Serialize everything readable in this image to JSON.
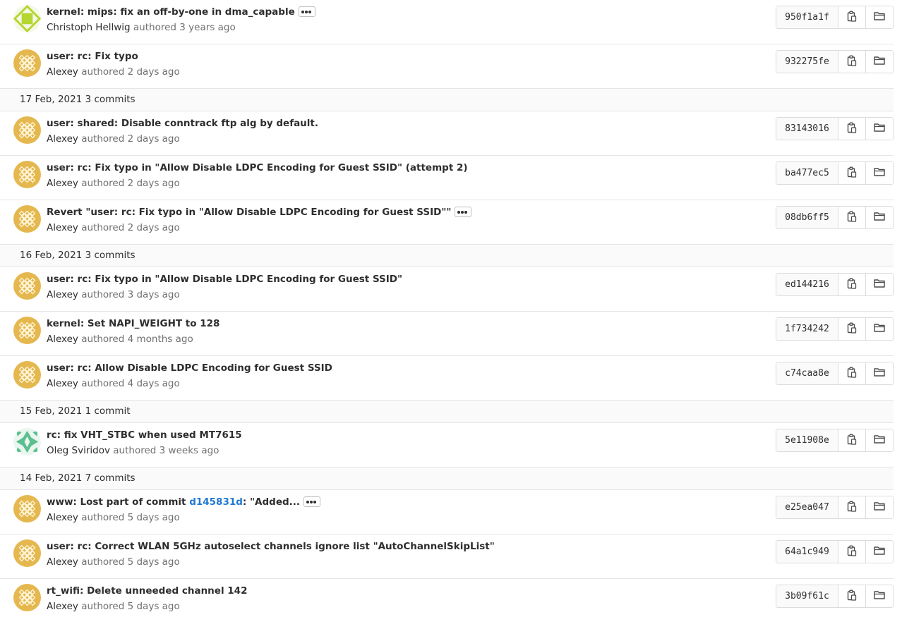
{
  "rows": [
    {
      "kind": "commit",
      "title": "kernel: mips: fix an off-by-one in dma_capable",
      "has_more": true,
      "author": "Christoph Hellwig",
      "authored_label": "authored",
      "time": "3 years ago",
      "sha": "950f1a1f",
      "avatar": "green"
    },
    {
      "kind": "commit",
      "title": "user: rc: Fix typo",
      "has_more": false,
      "author": "Alexey",
      "authored_label": "authored",
      "time": "2 days ago",
      "sha": "932275fe",
      "avatar": "gold"
    },
    {
      "kind": "day",
      "label": "17 Feb, 2021 3 commits"
    },
    {
      "kind": "commit",
      "title": "user: shared: Disable conntrack ftp alg by default.",
      "has_more": false,
      "author": "Alexey",
      "authored_label": "authored",
      "time": "2 days ago",
      "sha": "83143016",
      "avatar": "gold"
    },
    {
      "kind": "commit",
      "title": "user: rc: Fix typo in \"Allow Disable LDPC Encoding for Guest SSID\" (attempt 2)",
      "has_more": false,
      "author": "Alexey",
      "authored_label": "authored",
      "time": "2 days ago",
      "sha": "ba477ec5",
      "avatar": "gold"
    },
    {
      "kind": "commit",
      "title": "Revert \"user: rc: Fix typo in \"Allow Disable LDPC Encoding for Guest SSID\"\"",
      "has_more": true,
      "author": "Alexey",
      "authored_label": "authored",
      "time": "2 days ago",
      "sha": "08db6ff5",
      "avatar": "gold"
    },
    {
      "kind": "day",
      "label": "16 Feb, 2021 3 commits"
    },
    {
      "kind": "commit",
      "title": "user: rc: Fix typo in \"Allow Disable LDPC Encoding for Guest SSID\"",
      "has_more": false,
      "author": "Alexey",
      "authored_label": "authored",
      "time": "3 days ago",
      "sha": "ed144216",
      "avatar": "gold"
    },
    {
      "kind": "commit",
      "title": "kernel: Set NAPI_WEIGHT to 128",
      "has_more": false,
      "author": "Alexey",
      "authored_label": "authored",
      "time": "4 months ago",
      "sha": "1f734242",
      "avatar": "gold"
    },
    {
      "kind": "commit",
      "title": "user: rc: Allow Disable LDPC Encoding for Guest SSID",
      "has_more": false,
      "author": "Alexey",
      "authored_label": "authored",
      "time": "4 days ago",
      "sha": "c74caa8e",
      "avatar": "gold"
    },
    {
      "kind": "day",
      "label": "15 Feb, 2021 1 commit"
    },
    {
      "kind": "commit",
      "title": "rc: fix VHT_STBC when used MT7615",
      "has_more": false,
      "author": "Oleg Sviridov",
      "authored_label": "authored",
      "time": "3 weeks ago",
      "sha": "5e11908e",
      "avatar": "teal"
    },
    {
      "kind": "day",
      "label": "14 Feb, 2021 7 commits"
    },
    {
      "kind": "commit",
      "title": "www: Lost part of commit ",
      "title_link": "d145831d",
      "title_after": ": \"Added...",
      "has_more": true,
      "author": "Alexey",
      "authored_label": "authored",
      "time": "5 days ago",
      "sha": "e25ea047",
      "avatar": "gold"
    },
    {
      "kind": "commit",
      "title": "user: rc: Correct WLAN 5GHz autoselect channels ignore list \"AutoChannelSkipList\"",
      "has_more": false,
      "author": "Alexey",
      "authored_label": "authored",
      "time": "5 days ago",
      "sha": "64a1c949",
      "avatar": "gold"
    },
    {
      "kind": "commit",
      "title": "rt_wifi: Delete unneeded channel 142",
      "has_more": false,
      "author": "Alexey",
      "authored_label": "authored",
      "time": "5 days ago",
      "sha": "3b09f61c",
      "avatar": "gold"
    }
  ],
  "icons": {
    "copy": "clipboard-icon",
    "browse": "folder-icon",
    "more": "ellipsis-icon"
  },
  "colors": {
    "link": "#1f78d1",
    "avatar_gold": "#e5b84f",
    "avatar_green": "#b5d531",
    "avatar_teal": "#5bbf8e"
  }
}
